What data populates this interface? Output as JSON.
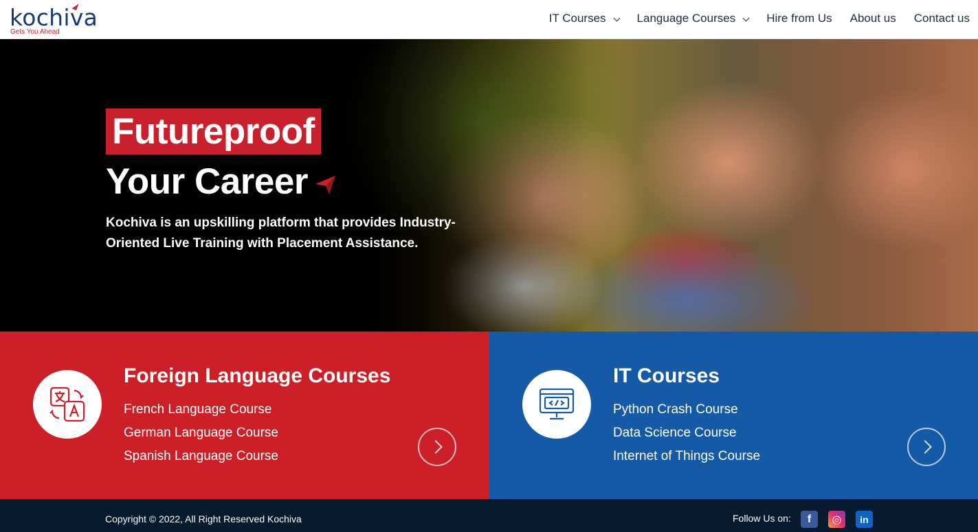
{
  "brand": {
    "name": "kochiva",
    "tagline": "Gets You Ahead"
  },
  "nav": {
    "items": [
      {
        "label": "IT Courses",
        "dropdown": true
      },
      {
        "label": "Language Courses",
        "dropdown": true
      },
      {
        "label": "Hire from Us",
        "dropdown": false
      },
      {
        "label": "About us",
        "dropdown": false
      },
      {
        "label": "Contact us",
        "dropdown": false
      }
    ]
  },
  "hero": {
    "highlight": "Futureproof",
    "title_line2": "Your Career",
    "description": "Kochiva is an upskilling platform that provides Industry-Oriented Live Training with Placement Assistance."
  },
  "panels": {
    "language": {
      "title": "Foreign Language Courses",
      "courses": [
        "French Language Course",
        "German Language Course",
        "Spanish Language Course"
      ],
      "icon": "translate-icon"
    },
    "it": {
      "title": "IT Courses",
      "courses": [
        "Python Crash Course",
        "Data Science Course",
        "Internet of Things Course"
      ],
      "icon": "code-monitor-icon"
    }
  },
  "footer": {
    "copyright": "Copyright © 2022, All Right Reserved Kochiva",
    "follow_label": "Follow Us on:",
    "social": [
      {
        "name": "facebook",
        "glyph": "f"
      },
      {
        "name": "instagram",
        "glyph": "◎"
      },
      {
        "name": "linkedin",
        "glyph": "in"
      }
    ]
  },
  "colors": {
    "brand_red": "#cc1f27",
    "brand_blue": "#145aa6",
    "footer_bg": "#071a2e",
    "logo_blue": "#183a73"
  }
}
